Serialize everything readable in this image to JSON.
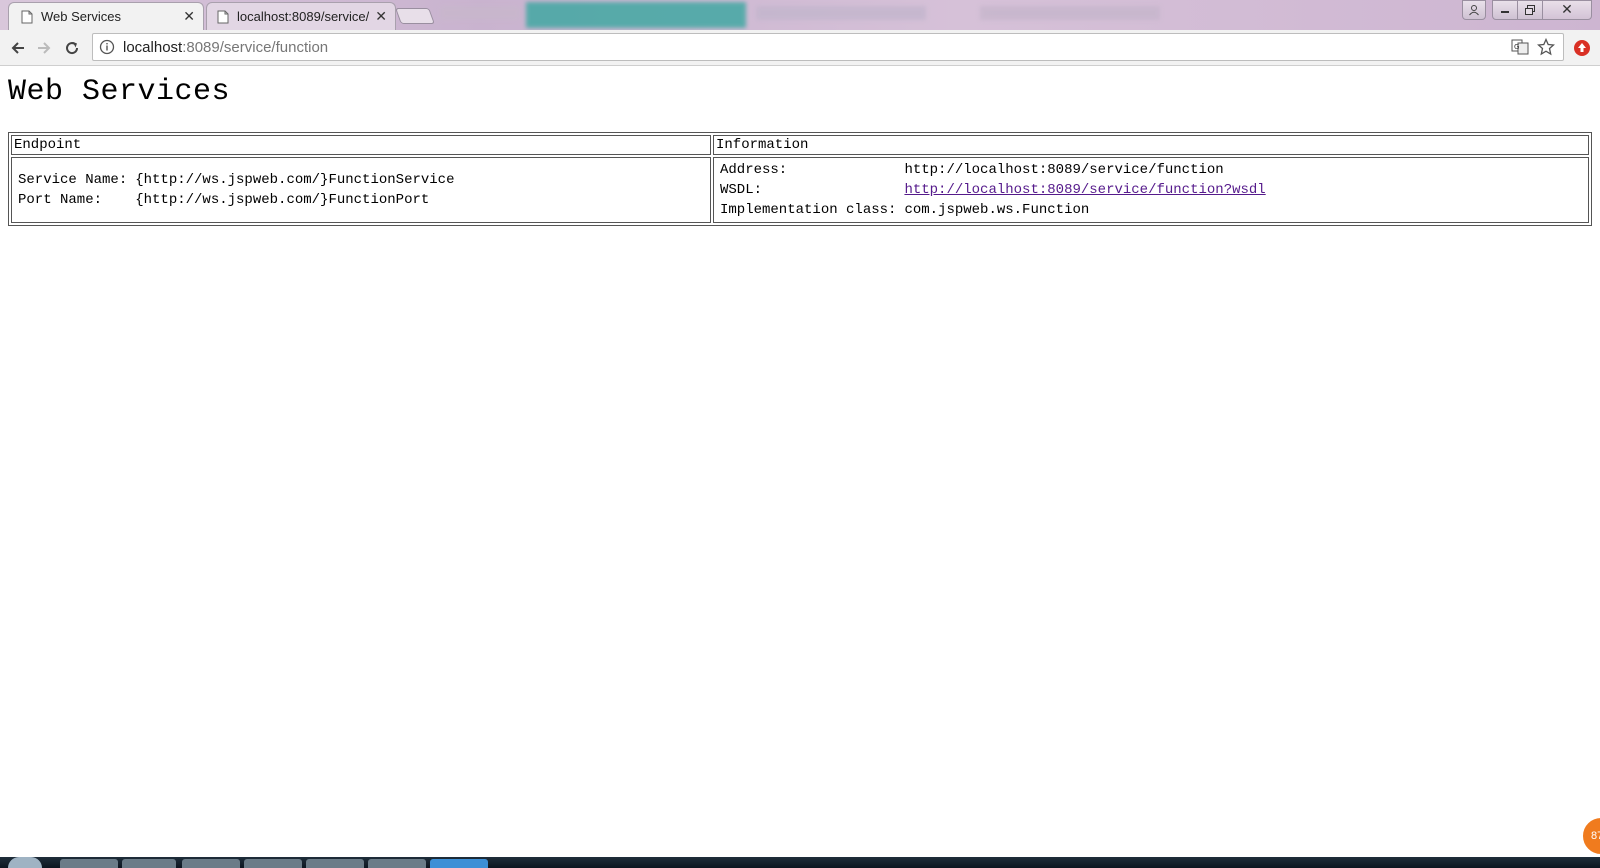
{
  "browser": {
    "tabs": [
      {
        "label": "Web Services",
        "active": true
      },
      {
        "label": "localhost:8089/service/",
        "active": false
      }
    ],
    "url_host": "localhost",
    "url_rest": ":8089/service/function",
    "window_controls": {
      "close_label": "✕"
    }
  },
  "page": {
    "title": "Web Services",
    "table": {
      "headers": {
        "endpoint": "Endpoint",
        "information": "Information"
      },
      "endpoint": {
        "service_name_label": "Service Name:",
        "service_name_value": "{http://ws.jspweb.com/}FunctionService",
        "port_name_label": "Port Name:",
        "port_name_value": "{http://ws.jspweb.com/}FunctionPort"
      },
      "information": {
        "address_label": "Address:",
        "address_value": "http://localhost:8089/service/function",
        "wsdl_label": "WSDL:",
        "wsdl_value": "http://localhost:8089/service/function?wsdl",
        "impl_label": "Implementation class:",
        "impl_value": "com.jspweb.ws.Function"
      }
    }
  },
  "overlay_badge": "87",
  "colors": {
    "link_visited": "#551a8b",
    "ext_icon_red": "#d93025",
    "badge_orange": "#f07b1e"
  }
}
